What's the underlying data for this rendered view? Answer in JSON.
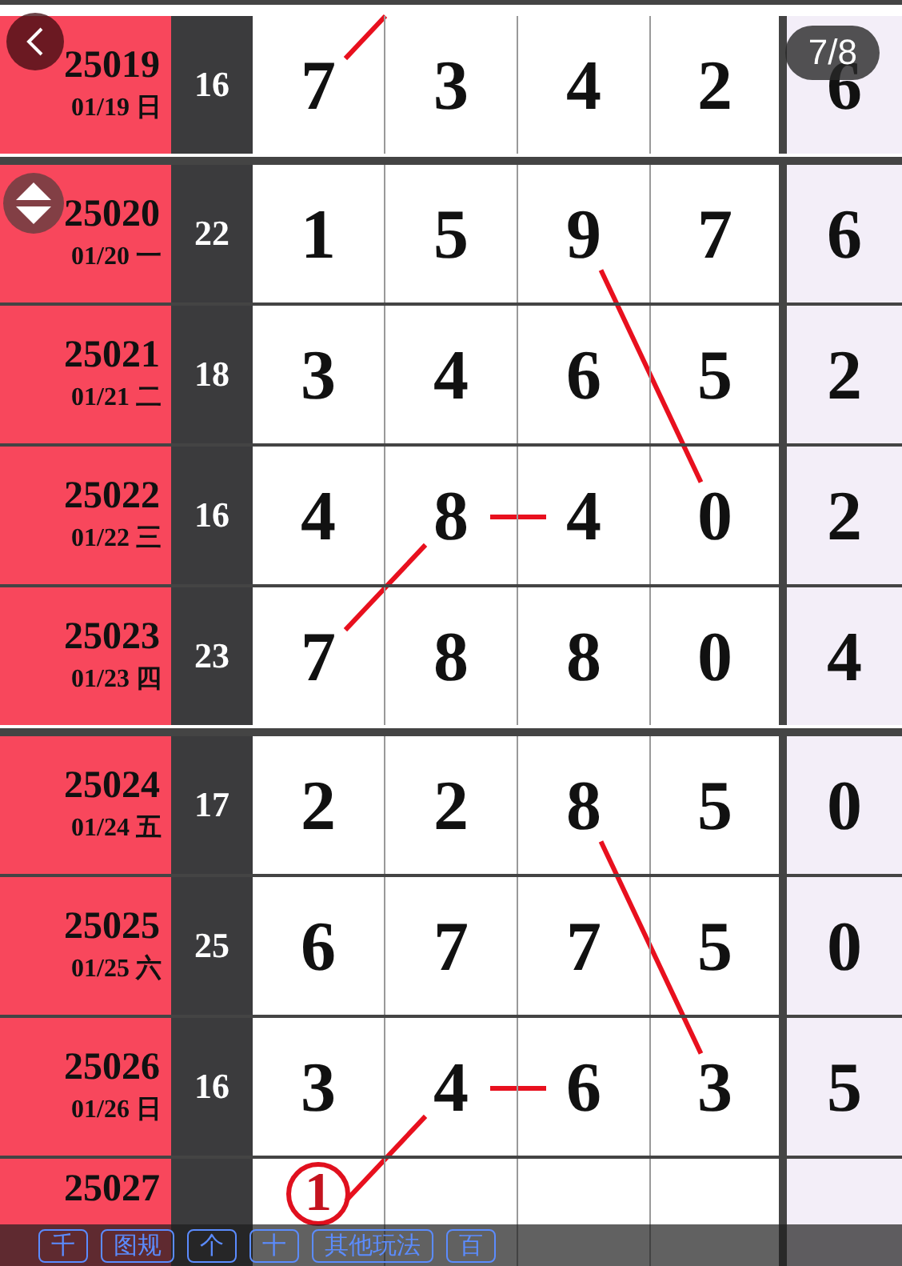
{
  "groups": [
    {
      "rows": [
        {
          "issue": "25019",
          "date": "01/19 日",
          "sum": "16",
          "digits": [
            "7",
            "3",
            "4",
            "2",
            "6"
          ],
          "circled": false
        }
      ]
    },
    {
      "rows": [
        {
          "issue": "25020",
          "date": "01/20 一",
          "sum": "22",
          "digits": [
            "1",
            "5",
            "9",
            "7",
            "6"
          ],
          "circled": false
        },
        {
          "issue": "25021",
          "date": "01/21 二",
          "sum": "18",
          "digits": [
            "3",
            "4",
            "6",
            "5",
            "2"
          ],
          "circled": false
        },
        {
          "issue": "25022",
          "date": "01/22 三",
          "sum": "16",
          "digits": [
            "4",
            "8",
            "4",
            "0",
            "2"
          ],
          "circled": false
        },
        {
          "issue": "25023",
          "date": "01/23 四",
          "sum": "23",
          "digits": [
            "7",
            "8",
            "8",
            "0",
            "4"
          ],
          "circled": false
        }
      ]
    },
    {
      "rows": [
        {
          "issue": "25024",
          "date": "01/24 五",
          "sum": "17",
          "digits": [
            "2",
            "2",
            "8",
            "5",
            "0"
          ],
          "circled": false
        },
        {
          "issue": "25025",
          "date": "01/25 六",
          "sum": "25",
          "digits": [
            "6",
            "7",
            "7",
            "5",
            "0"
          ],
          "circled": false
        },
        {
          "issue": "25026",
          "date": "01/26 日",
          "sum": "16",
          "digits": [
            "3",
            "4",
            "6",
            "3",
            "5"
          ],
          "circled": false
        },
        {
          "issue": "25027",
          "digits": [
            "1"
          ],
          "circled": true
        }
      ]
    }
  ],
  "page_badge": "7/8",
  "toolbar": [
    "千",
    "图规",
    "个",
    "十",
    "其他玩法",
    "百"
  ]
}
